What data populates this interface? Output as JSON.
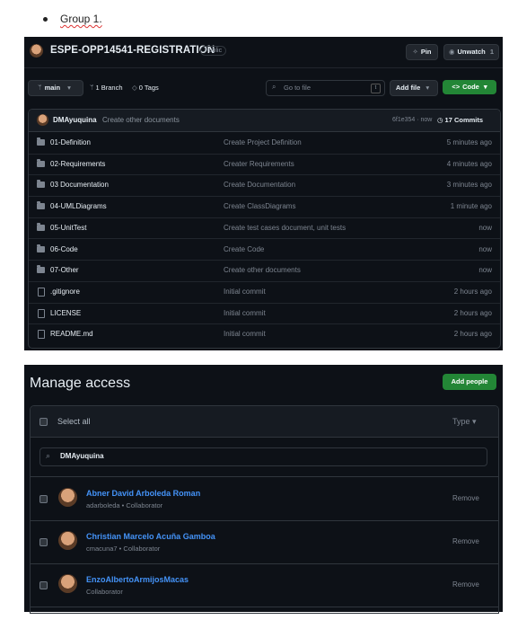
{
  "doc": {
    "bullet": "Group 1."
  },
  "repo": {
    "name": "ESPE-OPP14541-REGISTRATION",
    "visibility": "Public",
    "pin_label": "Pin",
    "unwatch_label": "Unwatch",
    "unwatch_count": "1",
    "branch_label": "main",
    "branches": "1 Branch",
    "tags": "0 Tags",
    "search_placeholder": "Go to file",
    "search_shortcut": "t",
    "add_file_label": "Add file",
    "code_label": "Code",
    "latest_commit": {
      "user": "DMAyuquina",
      "message": "Create other documents",
      "hash_time": "6f1e354 · now",
      "commits": "17 Commits"
    },
    "files": [
      {
        "type": "folder",
        "name": "01-Definition",
        "message": "Create Project Definition",
        "time": "5 minutes ago"
      },
      {
        "type": "folder",
        "name": "02-Requirements",
        "message": "Creater Requirements",
        "time": "4 minutes ago"
      },
      {
        "type": "folder",
        "name": "03 Documentation",
        "message": "Create Documentation",
        "time": "3 minutes ago"
      },
      {
        "type": "folder",
        "name": "04-UMLDiagrams",
        "message": "Create ClassDiagrams",
        "time": "1 minute ago"
      },
      {
        "type": "folder",
        "name": "05-UnitTest",
        "message": "Create test cases document, unit tests",
        "time": "now"
      },
      {
        "type": "folder",
        "name": "06-Code",
        "message": "Create Code",
        "time": "now"
      },
      {
        "type": "folder",
        "name": "07-Other",
        "message": "Create other documents",
        "time": "now"
      },
      {
        "type": "file",
        "name": ".gitignore",
        "message": "Initial commit",
        "time": "2 hours ago"
      },
      {
        "type": "file",
        "name": "LICENSE",
        "message": "Initial commit",
        "time": "2 hours ago"
      },
      {
        "type": "file",
        "name": "README.md",
        "message": "Initial commit",
        "time": "2 hours ago"
      }
    ]
  },
  "access": {
    "title": "Manage access",
    "add_people_label": "Add people",
    "select_all_label": "Select all",
    "type_filter_label": "Type",
    "search_value": "DMAyuquina",
    "members": [
      {
        "name": "Abner David Arboleda Roman",
        "sub": "adarboleda • Collaborator",
        "action": "Remove"
      },
      {
        "name": "Christian Marcelo Acuña Gamboa",
        "sub": "cmacuna7 • Collaborator",
        "action": "Remove"
      },
      {
        "name": "EnzoAlbertoArmijosMacas",
        "sub": "Collaborator",
        "action": "Remove"
      }
    ]
  },
  "colors": {
    "bg": "#0d1117",
    "accent_green": "#238636",
    "link_blue": "#4493f8",
    "muted": "#7d8590"
  }
}
